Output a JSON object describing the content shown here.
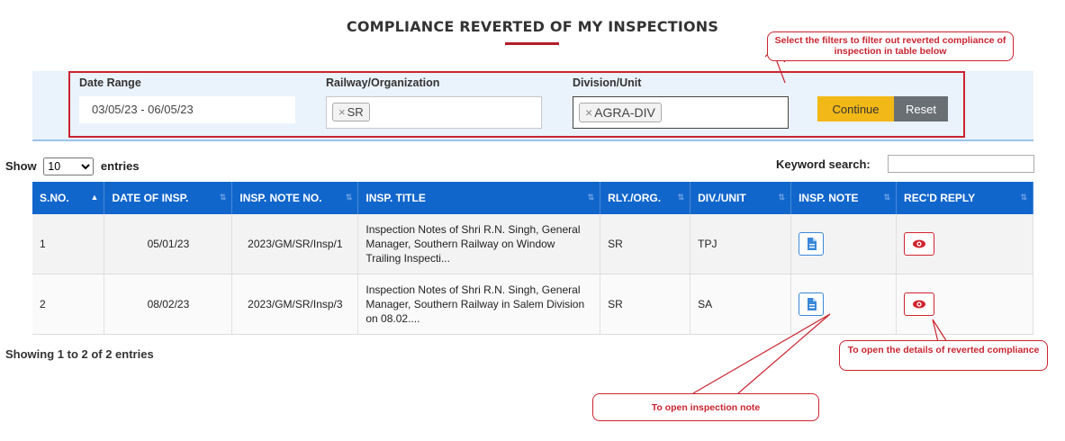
{
  "page_title": "COMPLIANCE REVERTED OF MY INSPECTIONS",
  "filters": {
    "date_label": "Date Range",
    "date_value": "03/05/23 - 06/05/23",
    "railway_label": "Railway/Organization",
    "railway_tag": "SR",
    "division_label": "Division/Unit",
    "division_tag": "AGRA-DIV",
    "continue_label": "Continue",
    "reset_label": "Reset"
  },
  "length": {
    "show": "Show",
    "value": "10",
    "entries": "entries"
  },
  "search": {
    "label": "Keyword search:"
  },
  "table": {
    "headers": [
      "S.NO.",
      "DATE OF INSP.",
      "INSP. NOTE NO.",
      "INSP. TITLE",
      "RLY./ORG.",
      "DIV./UNIT",
      "INSP. NOTE",
      "REC'D REPLY"
    ],
    "rows": [
      {
        "sno": "1",
        "date": "05/01/23",
        "note_no": "2023/GM/SR/Insp/1",
        "title": "Inspection Notes of Shri R.N. Singh, General Manager, Southern Railway on Window Trailing Inspecti...",
        "rly": "SR",
        "div": "TPJ"
      },
      {
        "sno": "2",
        "date": "08/02/23",
        "note_no": "2023/GM/SR/Insp/3",
        "title": "Inspection Notes of Shri R.N. Singh, General Manager, Southern Railway in Salem Division on 08.02....",
        "rly": "SR",
        "div": "SA"
      }
    ]
  },
  "info": "Showing 1 to 2 of 2 entries",
  "callouts": {
    "filters": "Select the filters to filter out reverted compliance of inspection in table below",
    "reply": "To open the details of reverted compliance",
    "note": "To open inspection note"
  },
  "colors": {
    "accent": "#c9242f",
    "header_blue": "#1166cc",
    "continue": "#f2b818",
    "reset": "#6a6f73"
  }
}
